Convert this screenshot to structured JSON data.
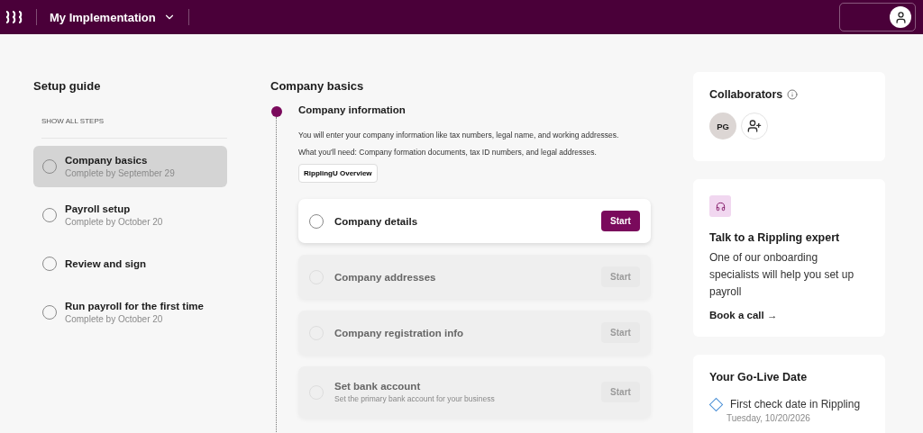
{
  "header": {
    "workspace": "My Implementation"
  },
  "setup_guide": {
    "title": "Setup guide",
    "show_all": "SHOW ALL STEPS",
    "items": [
      {
        "title": "Company basics",
        "subtitle": "Complete by September 29",
        "selected": true
      },
      {
        "title": "Payroll setup",
        "subtitle": "Complete by October 20",
        "selected": false
      },
      {
        "title": "Review and sign",
        "selected": false
      },
      {
        "title": "Run payroll for the first time",
        "subtitle": "Complete by October 20",
        "selected": false
      }
    ]
  },
  "section": {
    "title": "Company basics",
    "step_title": "Company information",
    "description": "You will enter your company information like tax numbers, legal name, and working addresses.",
    "needs": "What you'll need: Company formation documents, tax ID numbers, and legal addresses.",
    "link_button": "RipplingU Overview",
    "tasks": [
      {
        "title": "Company details",
        "action": "Start",
        "disabled": false
      },
      {
        "title": "Company addresses",
        "action": "Start",
        "disabled": true
      },
      {
        "title": "Company registration info",
        "action": "Start",
        "disabled": true
      },
      {
        "title": "Set bank account",
        "subtitle": "Set the primary bank account for your business",
        "action": "Start",
        "disabled": true
      }
    ]
  },
  "collaborators": {
    "title": "Collaborators",
    "people": [
      "PG"
    ]
  },
  "expert": {
    "title": "Talk to a Rippling expert",
    "text": "One of our onboarding specialists will help you set up payroll",
    "link": "Book a call →"
  },
  "go_live": {
    "title": "Your Go-Live Date",
    "item": "First check date in Rippling",
    "date": "Tuesday, 10/20/2026"
  }
}
